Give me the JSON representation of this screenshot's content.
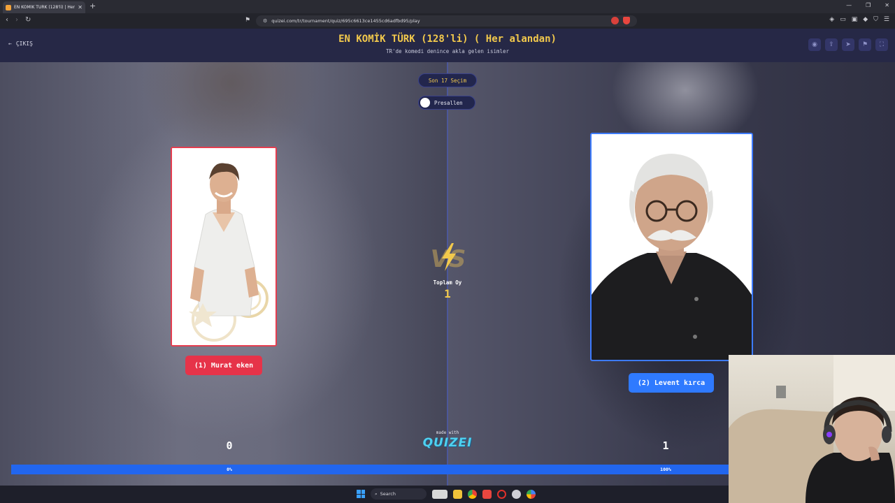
{
  "browser": {
    "tab_title": "EN KOMİK TÜRK (128'li) | Her al...",
    "url": "quizei.com/tr/tournament/quiz/695c6613ce1455cd6adfbd95/play"
  },
  "header": {
    "back_label": "ÇIKIŞ",
    "title": "EN KOMİK TÜRK (128'li) ( Her alandan)",
    "subtitle": "TR'de komedi denince akla gelen isimler"
  },
  "controls": {
    "son_secim": "Son 17 Seçim",
    "presallen": "Presallen"
  },
  "left": {
    "name_label": "(1) Murat eken",
    "score": "0",
    "percent_label": "0%",
    "percent": 0
  },
  "right": {
    "name_label": "(2) Levent kırca",
    "score": "1",
    "percent_label": "100%",
    "percent": 100
  },
  "center": {
    "vs_text": "VS",
    "toplam_label": "Toplam Oy",
    "toplam_value": "1"
  },
  "footer": {
    "made_with": "made with",
    "logo": "QUIZEI"
  },
  "taskbar": {
    "search_label": "Search"
  },
  "colors": {
    "accent_yellow": "#f2c94c",
    "left_red": "#e63349",
    "right_blue": "#2f7aff"
  }
}
